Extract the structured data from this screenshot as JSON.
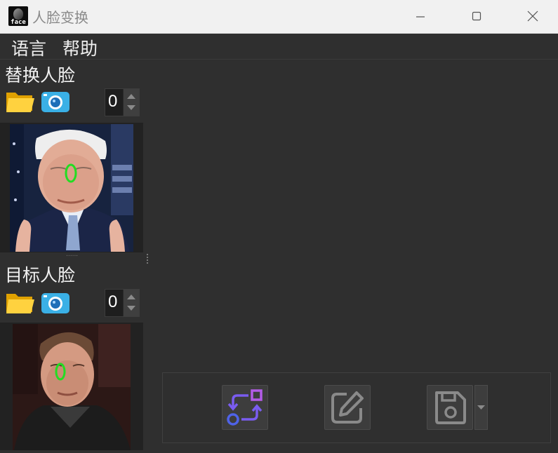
{
  "window": {
    "title": "人脸变换",
    "app_icon_label": "face",
    "controls": [
      "minimize-icon",
      "maximize-icon",
      "close-icon"
    ]
  },
  "menu": {
    "items": [
      {
        "label": "语言"
      },
      {
        "label": "帮助"
      }
    ]
  },
  "source_panel": {
    "title": "替换人脸",
    "open_icon": "folder-icon",
    "camera_icon": "camera-icon",
    "face_index": "0"
  },
  "target_panel": {
    "title": "目标人脸",
    "open_icon": "folder-icon",
    "camera_icon": "camera-icon",
    "face_index": "0"
  },
  "toolbar": {
    "swap_icon": "swap-icon",
    "edit_icon": "edit-icon",
    "save_icon": "save-icon",
    "dropdown_icon": "chevron-down-icon",
    "accent_color": "#7a5cf0",
    "disabled_color": "#8a8a8a"
  }
}
